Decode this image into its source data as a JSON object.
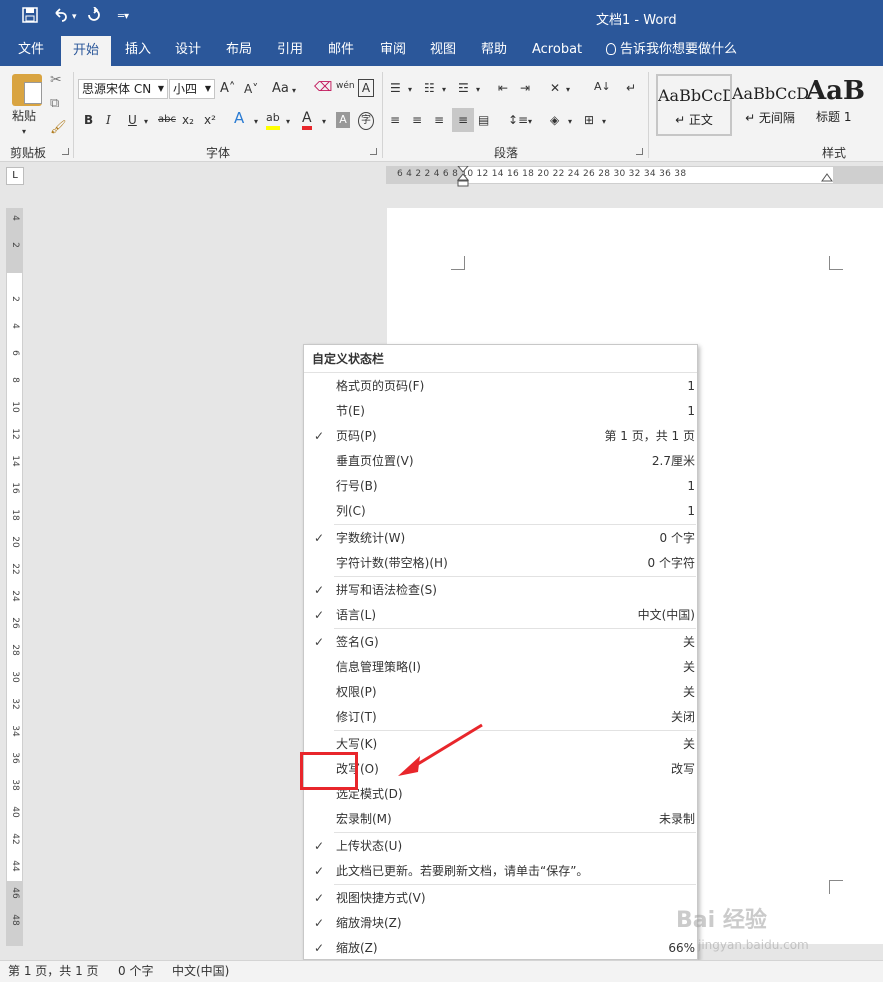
{
  "titlebar": {
    "title": "文档1  -  Word",
    "save_icon": "save-icon",
    "undo_icon": "undo-icon",
    "redo_icon": "redo-icon",
    "customize_icon": "customize-qat-icon"
  },
  "tabs": [
    {
      "label": "文件"
    },
    {
      "label": "开始"
    },
    {
      "label": "插入"
    },
    {
      "label": "设计"
    },
    {
      "label": "布局"
    },
    {
      "label": "引用"
    },
    {
      "label": "邮件"
    },
    {
      "label": "审阅"
    },
    {
      "label": "视图"
    },
    {
      "label": "帮助"
    },
    {
      "label": "Acrobat"
    },
    {
      "label": "告诉我你想要做什么"
    }
  ],
  "ribbon": {
    "clipboard": {
      "paste_label": "粘贴",
      "group_label": "剪贴板"
    },
    "font": {
      "font_name": "思源宋体 CN",
      "font_size": "小四",
      "group_label": "字体",
      "bold": "B",
      "italic": "I",
      "underline": "U",
      "strike": "abc",
      "subscript": "x₂",
      "superscript": "x²",
      "grow": "A˄",
      "shrink": "A˅",
      "case": "Aa",
      "font_color": "A",
      "phonetic": "wén",
      "border_char": "A",
      "enclose": "字"
    },
    "paragraph": {
      "group_label": "段落"
    },
    "styles": {
      "group_label": "样式",
      "items": [
        {
          "sample": "AaBbCcDd",
          "name": "↵ 正文"
        },
        {
          "sample": "AaBbCcDd",
          "name": "↵ 无间隔"
        },
        {
          "sample": "AaB",
          "name": "标题 1"
        }
      ]
    }
  },
  "ruler": {
    "h_numbers": "6   4   2       2   4   6   8   10  12  14  16  18  20  22  24  26  28  30  32  34  36  38",
    "v_numbers": [
      "4",
      "2",
      "",
      "2",
      "4",
      "6",
      "8",
      "10",
      "12",
      "14",
      "16",
      "18",
      "20",
      "22",
      "24",
      "26",
      "28",
      "30",
      "32",
      "34",
      "36",
      "38",
      "40",
      "42",
      "44",
      "46",
      "48"
    ],
    "corner": "L"
  },
  "menu": {
    "title": "自定义状态栏",
    "items": [
      {
        "checked": false,
        "label": "格式页的页码(F)",
        "value": "1"
      },
      {
        "checked": false,
        "label": "节(E)",
        "value": "1"
      },
      {
        "checked": true,
        "label": "页码(P)",
        "value": "第 1 页，共 1 页"
      },
      {
        "checked": false,
        "label": "垂直页位置(V)",
        "value": "2.7厘米"
      },
      {
        "checked": false,
        "label": "行号(B)",
        "value": "1"
      },
      {
        "checked": false,
        "label": "列(C)",
        "value": "1"
      },
      {
        "checked": true,
        "label": "字数统计(W)",
        "value": "0 个字"
      },
      {
        "checked": false,
        "label": "字符计数(带空格)(H)",
        "value": "0 个字符"
      },
      {
        "checked": true,
        "label": "拼写和语法检查(S)",
        "value": ""
      },
      {
        "checked": true,
        "label": "语言(L)",
        "value": "中文(中国)"
      },
      {
        "checked": true,
        "label": "签名(G)",
        "value": "关"
      },
      {
        "checked": false,
        "label": "信息管理策略(I)",
        "value": "关"
      },
      {
        "checked": false,
        "label": "权限(P)",
        "value": "关"
      },
      {
        "checked": false,
        "label": "修订(T)",
        "value": "关闭"
      },
      {
        "checked": false,
        "label": "大写(K)",
        "value": "关"
      },
      {
        "checked": false,
        "label": "改写(O)",
        "value": "改写"
      },
      {
        "checked": false,
        "label": "选定模式(D)",
        "value": ""
      },
      {
        "checked": false,
        "label": "宏录制(M)",
        "value": "未录制"
      },
      {
        "checked": true,
        "label": "上传状态(U)",
        "value": ""
      },
      {
        "checked": true,
        "label": "此文档已更新。若要刷新文档，请单击“保存”。",
        "value": ""
      },
      {
        "checked": true,
        "label": "视图快捷方式(V)",
        "value": ""
      },
      {
        "checked": true,
        "label": "缩放滑块(Z)",
        "value": ""
      },
      {
        "checked": true,
        "label": "缩放(Z)",
        "value": "66%"
      }
    ],
    "check_glyph": "✓"
  },
  "statusbar": {
    "page": "第 1 页，共 1 页",
    "words": "0 个字",
    "language": "中文(中国)"
  },
  "watermark": {
    "brand": "Bai 经验",
    "url": "jingyan.baidu.com"
  },
  "colors": {
    "brand": "#2b579a",
    "highlight": "#e8262b"
  }
}
